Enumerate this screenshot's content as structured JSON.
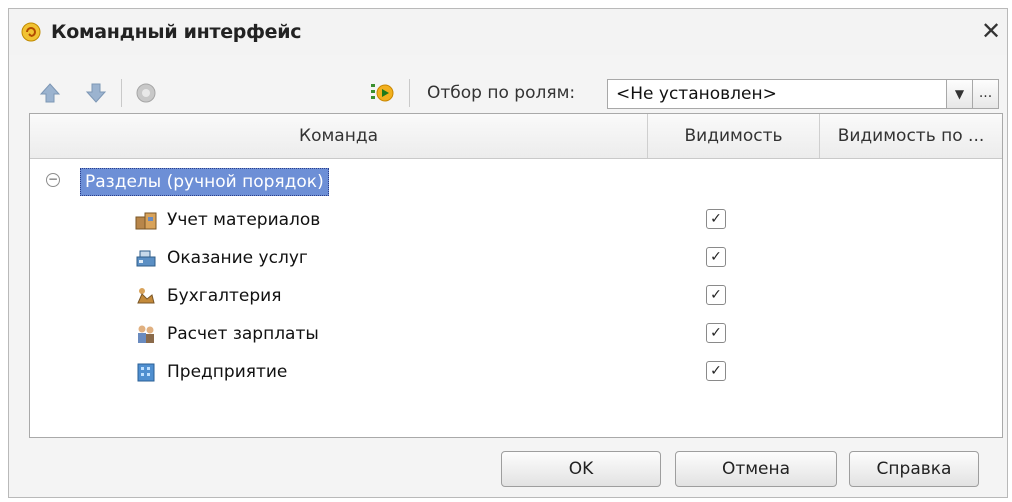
{
  "window": {
    "title": "Командный интерфейс",
    "close_glyph": "✕"
  },
  "toolbar": {
    "move_up_icon": "arrow-up-icon",
    "move_down_icon": "arrow-down-icon",
    "refresh_icon": "refresh-icon",
    "run_icon": "run-icon",
    "filter_label": "Отбор по ролям:",
    "filter_value": "<Не установлен>",
    "dropdown_glyph": "▼",
    "more_glyph": "..."
  },
  "grid": {
    "columns": [
      "Команда",
      "Видимость",
      "Видимость по ..."
    ],
    "group": {
      "label": "Разделы (ручной порядок)",
      "collapse_glyph": "−"
    },
    "items": [
      {
        "label": "Учет материалов",
        "visible": true,
        "icon": "warehouse-icon"
      },
      {
        "label": "Оказание услуг",
        "visible": true,
        "icon": "cash-register-icon"
      },
      {
        "label": "Бухгалтерия",
        "visible": true,
        "icon": "accounting-icon"
      },
      {
        "label": "Расчет зарплаты",
        "visible": true,
        "icon": "people-icon"
      },
      {
        "label": "Предприятие",
        "visible": true,
        "icon": "enterprise-icon"
      }
    ],
    "check_glyph": "✓"
  },
  "buttons": {
    "ok": "OK",
    "cancel": "Отмена",
    "help": "Справка"
  },
  "colors": {
    "selection": "#6d8fd6",
    "arrow": "#8fa9c8"
  }
}
